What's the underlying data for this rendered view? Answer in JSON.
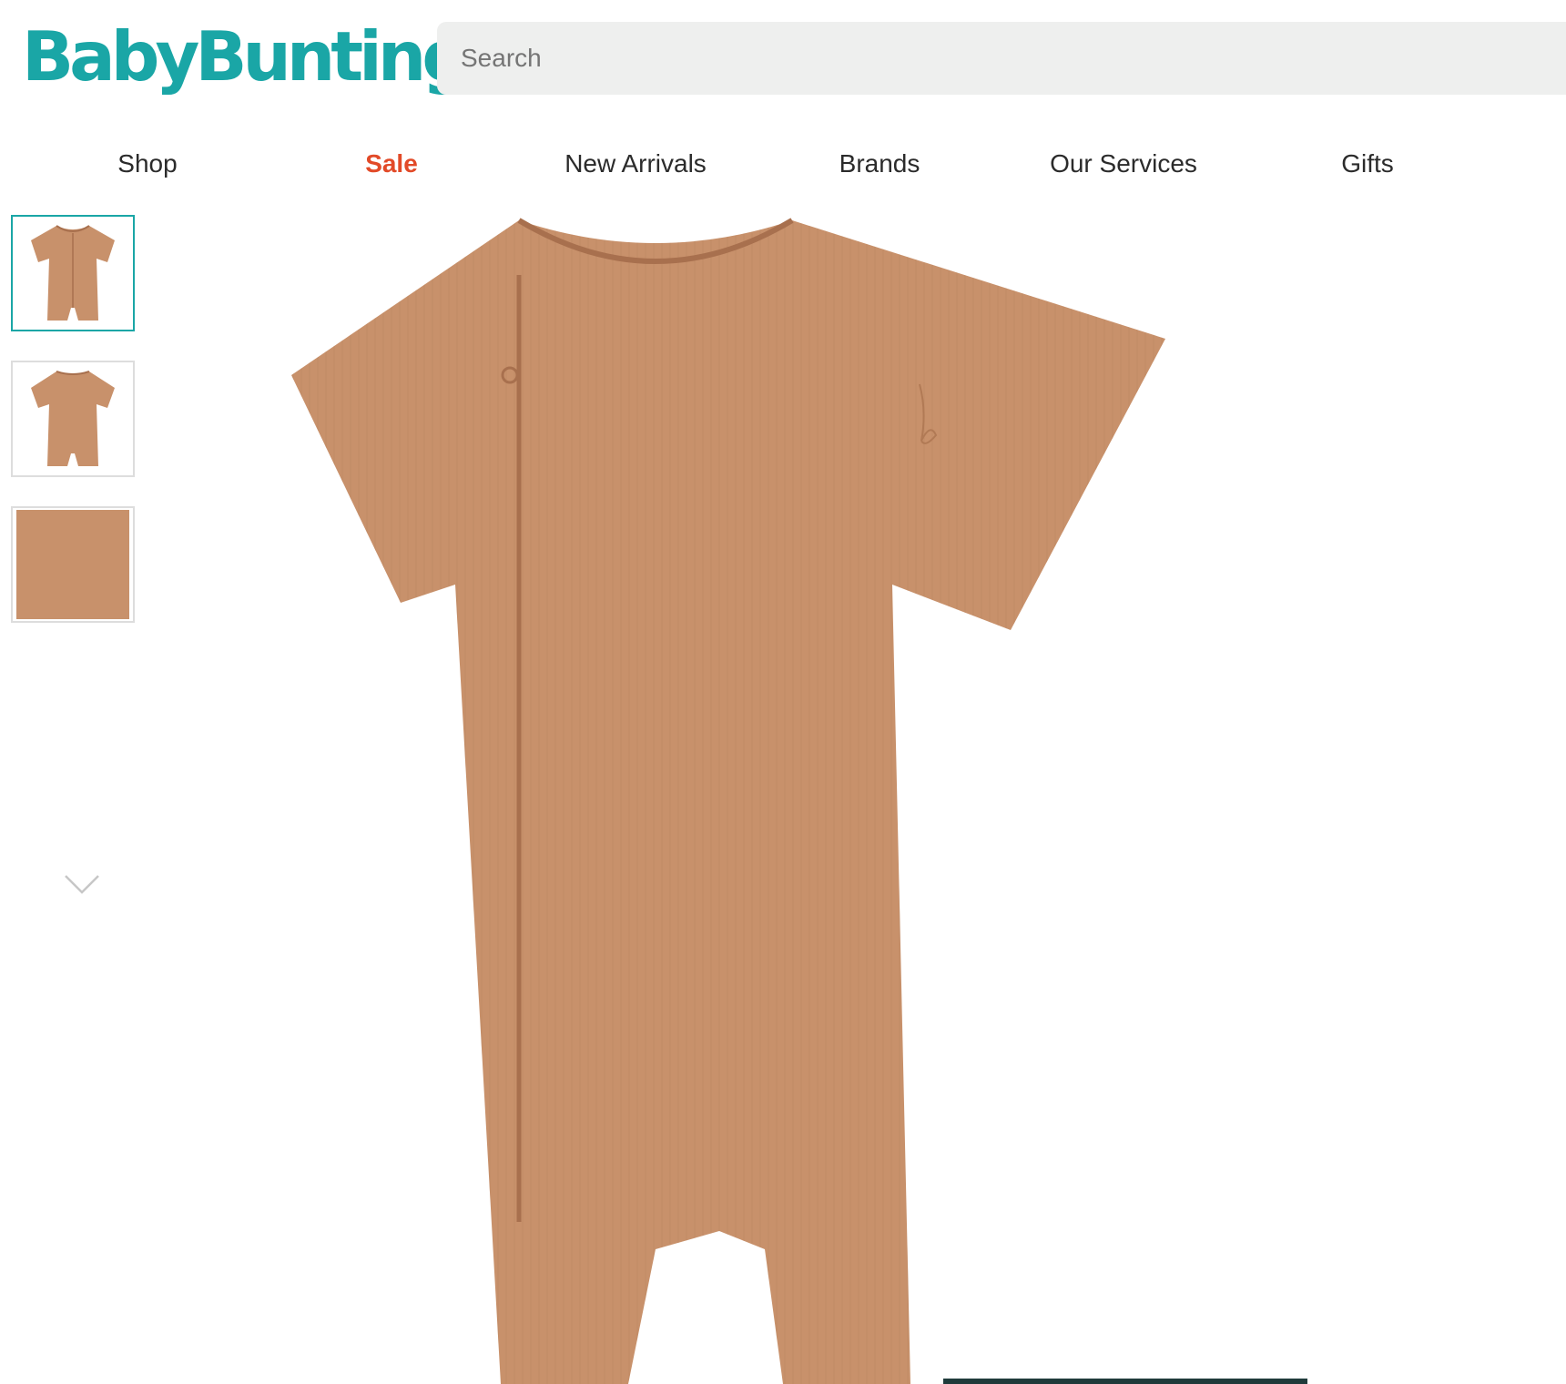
{
  "brand": {
    "logo_text": "BabyBunting",
    "accent_color": "#1aa6a6",
    "sale_color": "#e24a28"
  },
  "search": {
    "placeholder": "Search"
  },
  "nav": {
    "items": [
      "Shop",
      "Sale",
      "New Arrivals",
      "Brands",
      "Our Services",
      "Gifts"
    ]
  },
  "gallery": {
    "thumbnails": [
      "romper-front",
      "romper-back",
      "fabric-detail"
    ],
    "selected_index": 0,
    "more_icon": "chevron-down-icon",
    "product_color": "#c8916b"
  }
}
